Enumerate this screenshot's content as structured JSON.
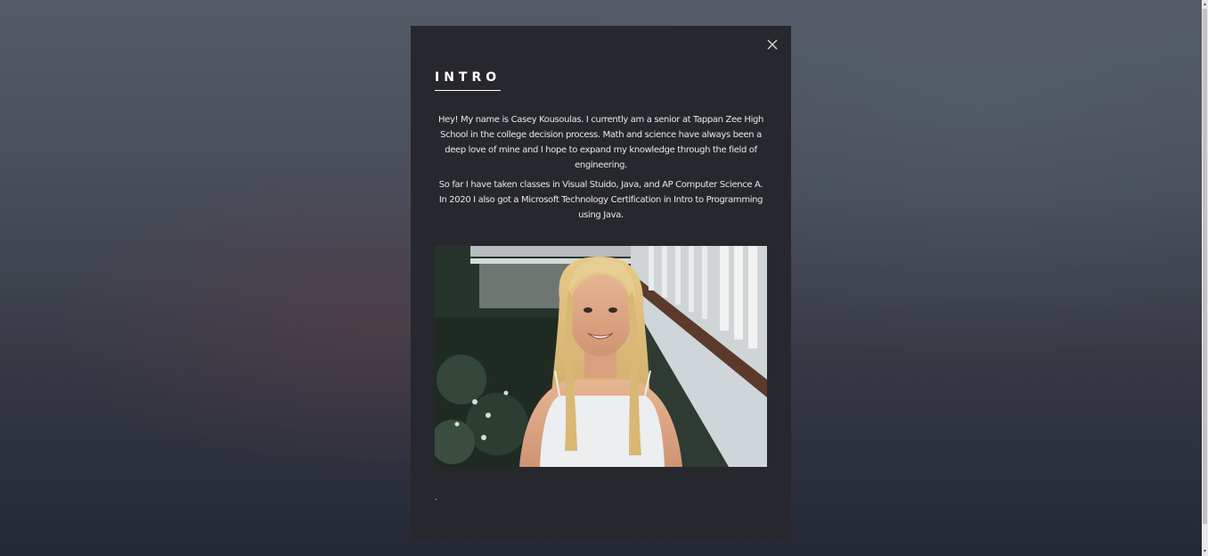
{
  "modal": {
    "title": "INTRO",
    "close_icon": "close-icon",
    "paragraph1": "Hey! My name is Casey Kousoulas. I currently am a senior at Tappan Zee High School in the college decision process. Math and science have always been a deep love of mine and I hope to expand my knowledge through the field of engineering.",
    "paragraph2_line1": "So far I have taken classes in Visual Stuido, Java, and AP Computer Science A.",
    "paragraph2_line2": "In 2020 I also got a Microsoft Technology Certification in Intro to Programming using Java.",
    "trailing_text": ".",
    "photo_alt": "Portrait photo"
  },
  "scrollbar": {
    "up_arrow": "▴",
    "down_arrow": "▾"
  }
}
